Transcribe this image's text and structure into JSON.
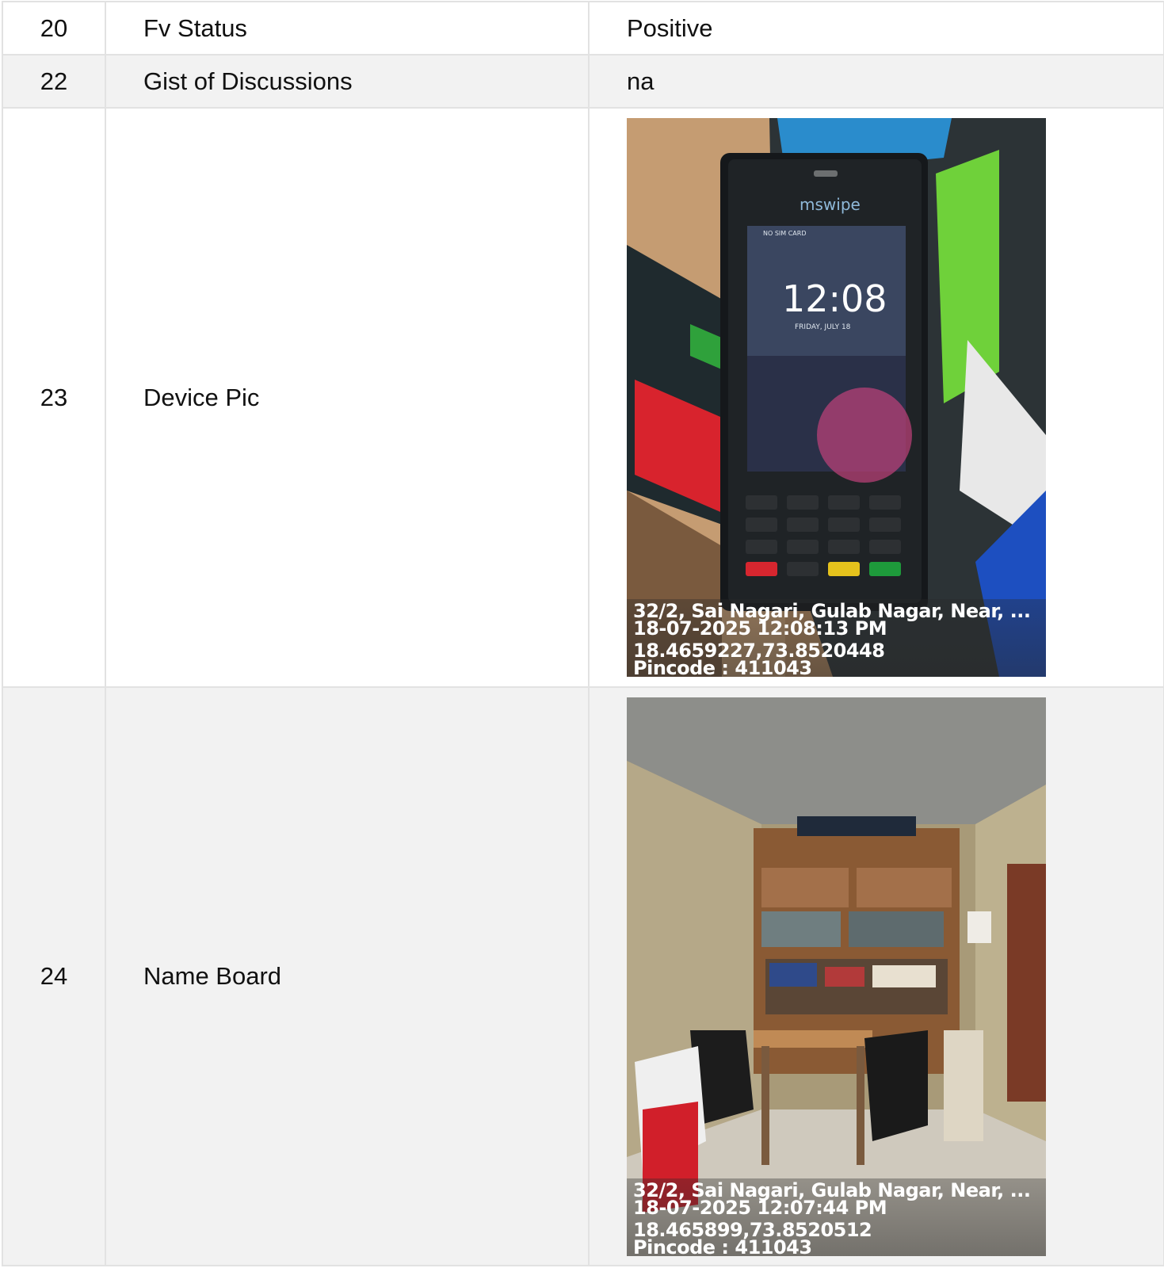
{
  "rows": [
    {
      "num": "20",
      "label": "Fv Status",
      "value": "Positive"
    },
    {
      "num": "22",
      "label": "Gist of Discussions",
      "value": "na"
    },
    {
      "num": "23",
      "label": "Device Pic",
      "image": {
        "description_icon": "card-terminal-photo",
        "brand": "mswipe",
        "screen_time": "12:08",
        "screen_date": "FRIDAY, JULY 18",
        "screen_status": "NO SIM CARD",
        "address": "32/2, Sai Nagari, Gulab Nagar, Near, ...",
        "datetime": "18-07-2025 12:08:13 PM",
        "coords": "18.4659227,73.8520448",
        "pincode": "Pincode : 411043"
      }
    },
    {
      "num": "24",
      "label": "Name Board",
      "image": {
        "description_icon": "shop-interior-photo",
        "address": "32/2, Sai Nagari, Gulab Nagar, Near, ...",
        "datetime": "18-07-2025 12:07:44 PM",
        "coords": "18.465899,73.8520512",
        "pincode": "Pincode : 411043"
      }
    }
  ],
  "colors": {
    "border": "#e2e2e2",
    "row_alt": "#f2f2f2"
  }
}
